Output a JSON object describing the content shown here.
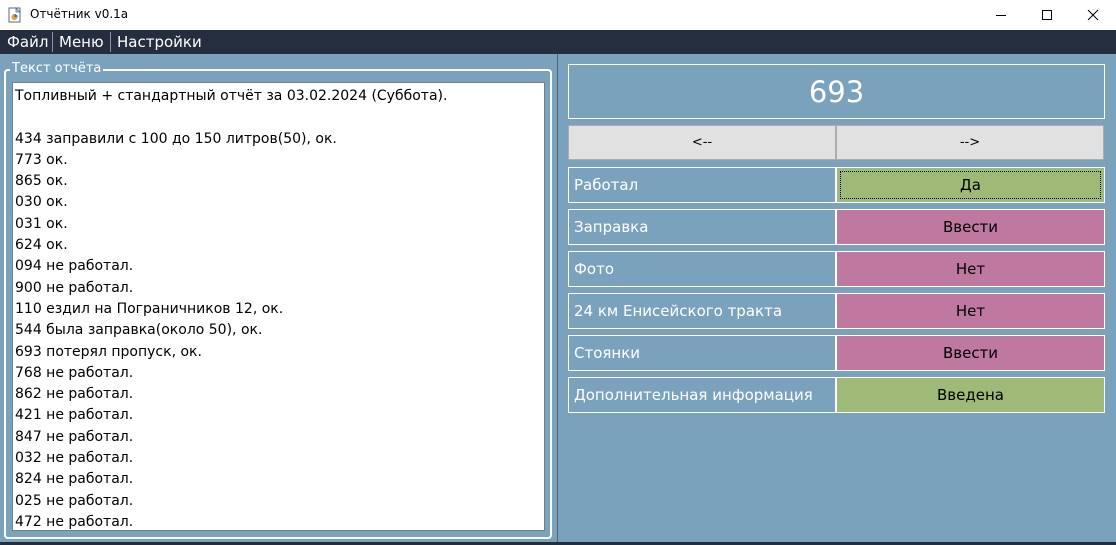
{
  "window": {
    "title": "Отчётник v0.1a",
    "controls": [
      "minimize-icon",
      "maximize-icon",
      "close-icon"
    ]
  },
  "menu": {
    "items": [
      {
        "label": "Файл"
      },
      {
        "label": "Меню"
      },
      {
        "label": "Настройки"
      }
    ]
  },
  "report": {
    "group_label": "Текст отчёта",
    "lines": [
      "Топливный + стандартный отчёт за 03.02.2024 (Суббота).",
      "",
      "434 заправили с 100 до 150 литров(50), ок.",
      "773 ок.",
      "865 ок.",
      "030 ок.",
      "031 ок.",
      "624 ок.",
      "094 не работал.",
      "900 не работал.",
      "110 ездил на Пограничников 12, ок.",
      "544 была заправка(около 50), ок.",
      "693 потерял пропуск, ок.",
      "768 не работал.",
      "862 не работал.",
      "421 не работал.",
      "847 не работал.",
      "032 не работал.",
      "824 не работал.",
      "025 не работал.",
      "472 не работал."
    ]
  },
  "panel": {
    "vehicle_number": "693",
    "prev_label": "<--",
    "next_label": "-->",
    "fields": [
      {
        "label": "Работал",
        "value": "Да",
        "state": "ok",
        "focused": true
      },
      {
        "label": "Заправка",
        "value": "Ввести",
        "state": "pending",
        "focused": false
      },
      {
        "label": "Фото",
        "value": "Нет",
        "state": "pending",
        "focused": false
      },
      {
        "label": "24 км Енисейского тракта",
        "value": "Нет",
        "state": "pending",
        "focused": false
      },
      {
        "label": "Стоянки",
        "value": "Ввести",
        "state": "pending",
        "focused": false
      },
      {
        "label": "Дополнительная информация",
        "value": "Введена",
        "state": "ok",
        "focused": false
      }
    ]
  },
  "colors": {
    "ok": "#9fba77",
    "pending": "#bf79a1",
    "panel_bg": "#7ba2bc",
    "menubar": "#252e3e"
  }
}
